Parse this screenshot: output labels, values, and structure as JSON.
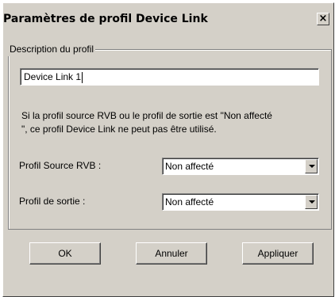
{
  "window": {
    "title": "Paramètres de profil Device Link",
    "close_symbol": "×"
  },
  "group": {
    "legend": "Description du profil",
    "name_value": "Device Link 1",
    "info_line1": "Si la profil source RVB ou le profil de sortie est \"Non affecté",
    "info_line2": "\", ce profil Device Link ne peut pas être utilisé.",
    "source_label": "Profil Source RVB :",
    "source_value": "Non affecté",
    "output_label": "Profil de sortie :",
    "output_value": "Non affecté"
  },
  "buttons": {
    "ok": "OK",
    "cancel": "Annuler",
    "apply": "Appliquer"
  }
}
